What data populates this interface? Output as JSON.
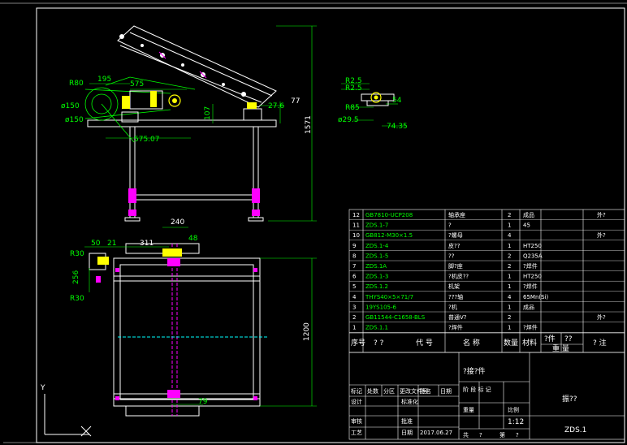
{
  "dims": {
    "r80": "R80",
    "d195": "195",
    "d575": "575",
    "r150": "ø150",
    "r150b": "ø150",
    "d575_07": "575.07",
    "d107": "107",
    "d27_6": "27.6",
    "d77": "77",
    "d1571": "1571",
    "d240": "240",
    "d311": "311",
    "d50": "50",
    "d21": "21",
    "d48": "48",
    "r30a": "R30",
    "r30b": "R30",
    "d256": "256",
    "d1200": "1200",
    "d79": "79",
    "r2_5a": "R2.5",
    "r2_5b": "R2.5",
    "r85": "R85",
    "d54": "54",
    "d74_35": "74.35",
    "d29_5": "ø29.5"
  },
  "axis": {
    "y": "Y"
  },
  "bom": {
    "rows": [
      {
        "no": "12",
        "code": "GB7810-UCP208",
        "name": "轴承座",
        "qty": "2",
        "mat": "成品",
        "note": "外?"
      },
      {
        "no": "11",
        "code": "ZDS.1-7",
        "name": "?",
        "qty": "1",
        "mat": "45",
        "note": ""
      },
      {
        "no": "10",
        "code": "GB812-M30×1.5",
        "name": "?螺母",
        "qty": "4",
        "mat": "",
        "note": "外?"
      },
      {
        "no": "9",
        "code": "ZDS.1-4",
        "name": "皮??",
        "qty": "1",
        "mat": "HT250",
        "note": ""
      },
      {
        "no": "8",
        "code": "ZDS.1-5",
        "name": "??",
        "qty": "2",
        "mat": "Q235A",
        "note": ""
      },
      {
        "no": "7",
        "code": "ZDS.1A",
        "name": "脚?座",
        "qty": "2",
        "mat": "?焊件",
        "note": ""
      },
      {
        "no": "6",
        "code": "ZDS.1-3",
        "name": "?机皮??",
        "qty": "1",
        "mat": "HT250",
        "note": ""
      },
      {
        "no": "5",
        "code": "ZDS.1.2",
        "name": "机架",
        "qty": "1",
        "mat": "?焊件",
        "note": ""
      },
      {
        "no": "4",
        "code": "THYS40×5×71/7",
        "name": "???轴",
        "qty": "4",
        "mat": "65Mn(Si)",
        "note": ""
      },
      {
        "no": "3",
        "code": "19YS105-6",
        "name": "?机",
        "qty": "1",
        "mat": "成品",
        "note": ""
      },
      {
        "no": "2",
        "code": "GB11544-C1658-BLS",
        "name": "普通V?",
        "qty": "2",
        "mat": "",
        "note": "外?"
      },
      {
        "no": "1",
        "code": "ZDS.1.1",
        "name": "?焊件",
        "qty": "1",
        "mat": "?焊件",
        "note": ""
      }
    ],
    "header": {
      "no": "序号",
      "code": "代  号",
      "dai": "? ?",
      "name": "名  称",
      "qty": "数量",
      "mat": "材料",
      "single": "?件",
      "total": "?? ",
      "weight": "重  量",
      "note": "?  注"
    }
  },
  "title_block": {
    "part_name": "?接?件",
    "mark": "标记",
    "count": "处数",
    "zone": "分区",
    "change": "更改文件号",
    "sign": "签名",
    "date": "日期",
    "design": "设计",
    "std": "标准化",
    "stage": "阶 段 标 记",
    "weight": "重量",
    "scale": "比例",
    "check": "审核",
    "craft": "工艺",
    "approve": "批准",
    "date2": "日期",
    "date_val": "2017.06.27",
    "scale_val": "1:12",
    "total": "共",
    "sheet": "第",
    "total_val": "?",
    "sheet_val": "?",
    "drawing_no": "ZDS.1",
    "company": "振??"
  }
}
